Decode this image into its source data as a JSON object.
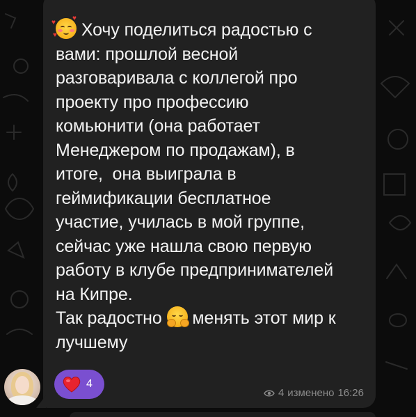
{
  "message": {
    "line1": "Хочу поделиться радостью с",
    "lines": [
      "вами: прошлой весной",
      "разговаривала с коллегой про",
      "проекту про профессию",
      "комьюнити (она работает",
      "Менеджером по продажам), в",
      "итоге,  она выиграла в",
      "геймификации бесплатное",
      "участие, училась в мой группе,",
      "сейчас уже нашла свою первую",
      "работу в клубе предпринимателей",
      "на Кипре."
    ],
    "line13_start": "Так радостно",
    "line13_end": "менять этот мир к",
    "line14": "лучшему",
    "leading_emoji": "smiling-face-with-hearts-icon",
    "inline_emoji": "hugging-face-icon"
  },
  "reaction": {
    "emoji": "heart-icon",
    "count": "4",
    "color": "#7a4fd0"
  },
  "meta": {
    "views": "4",
    "edited_label": "изменено",
    "time": "16:26"
  },
  "colors": {
    "background": "#0c0c0c",
    "bubble": "#212121",
    "text": "#f2f2f2",
    "meta": "#8b8b8b"
  }
}
